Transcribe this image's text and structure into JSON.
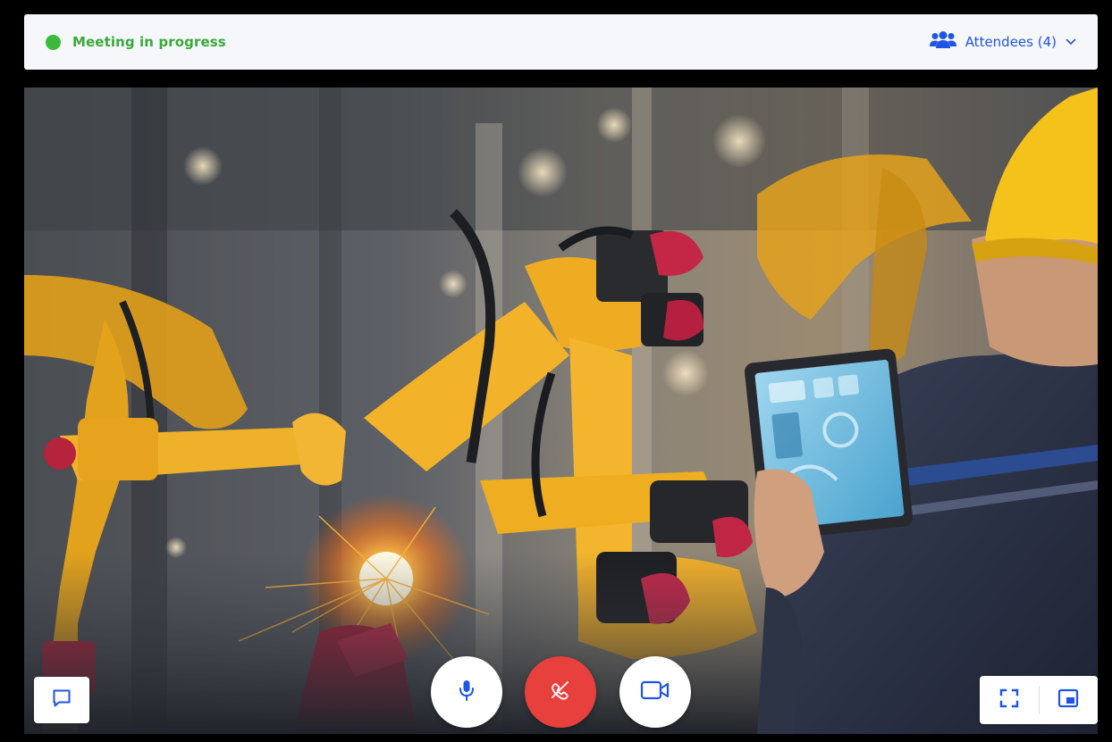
{
  "status": {
    "label": "Meeting in progress",
    "color": "#3bbb3b"
  },
  "attendees": {
    "label": "Attendees (4)",
    "icon": "users-icon",
    "color": "#1f55e6"
  },
  "controls": {
    "chat": {
      "icon": "chat-bubble-icon"
    },
    "microphone": {
      "icon": "microphone-icon"
    },
    "hang_up": {
      "icon": "phone-hangup-icon",
      "color": "#e8403d"
    },
    "camera": {
      "icon": "video-camera-icon"
    },
    "fullscreen": {
      "icon": "fullscreen-icon"
    },
    "picture_in_picture": {
      "icon": "picture-in-picture-icon"
    }
  },
  "video": {
    "description_icon": "industrial-robot-video-feed"
  }
}
